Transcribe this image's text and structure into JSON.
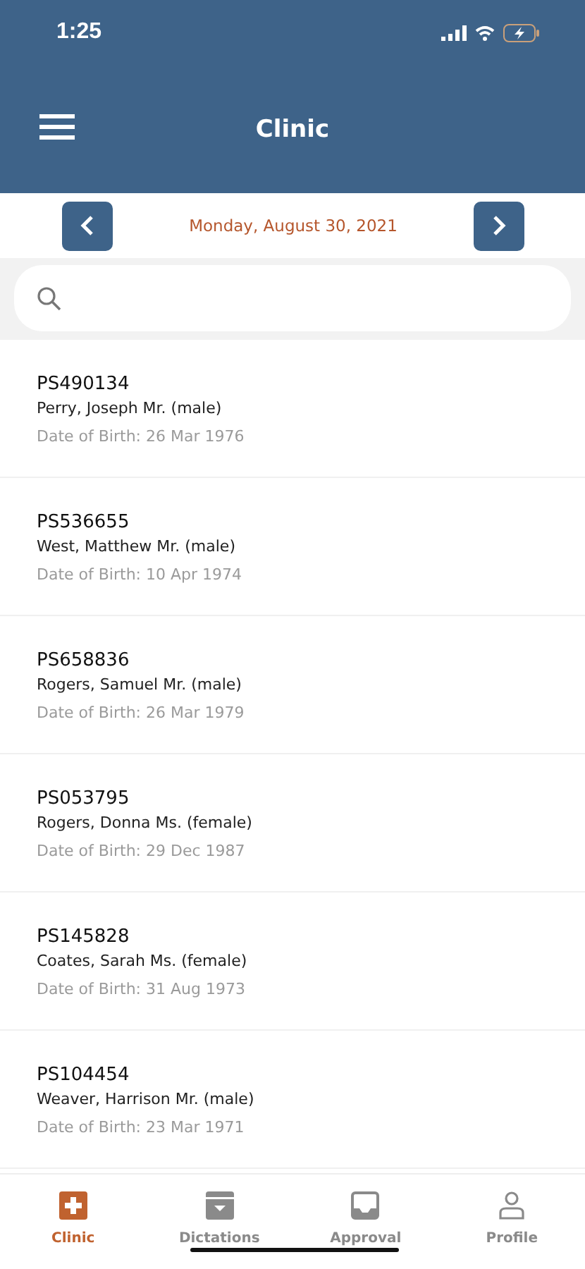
{
  "status_bar": {
    "time": "1:25"
  },
  "header": {
    "title": "Clinic"
  },
  "date_nav": {
    "date": "Monday, August 30, 2021"
  },
  "patients": [
    {
      "id": "PS490134",
      "name": "Perry, Joseph Mr. (male)",
      "dob": "Date of Birth: 26 Mar 1976"
    },
    {
      "id": "PS536655",
      "name": "West, Matthew Mr. (male)",
      "dob": "Date of Birth: 10 Apr 1974"
    },
    {
      "id": "PS658836",
      "name": "Rogers, Samuel Mr. (male)",
      "dob": "Date of Birth: 26 Mar 1979"
    },
    {
      "id": "PS053795",
      "name": "Rogers, Donna Ms. (female)",
      "dob": "Date of Birth: 29 Dec 1987"
    },
    {
      "id": "PS145828",
      "name": "Coates, Sarah Ms. (female)",
      "dob": "Date of Birth: 31 Aug 1973"
    },
    {
      "id": "PS104454",
      "name": "Weaver, Harrison Mr. (male)",
      "dob": "Date of Birth: 23 Mar 1971"
    }
  ],
  "tabs": [
    {
      "label": "Clinic",
      "selected": true
    },
    {
      "label": "Dictations",
      "selected": false
    },
    {
      "label": "Approval",
      "selected": false
    },
    {
      "label": "Profile",
      "selected": false
    }
  ]
}
